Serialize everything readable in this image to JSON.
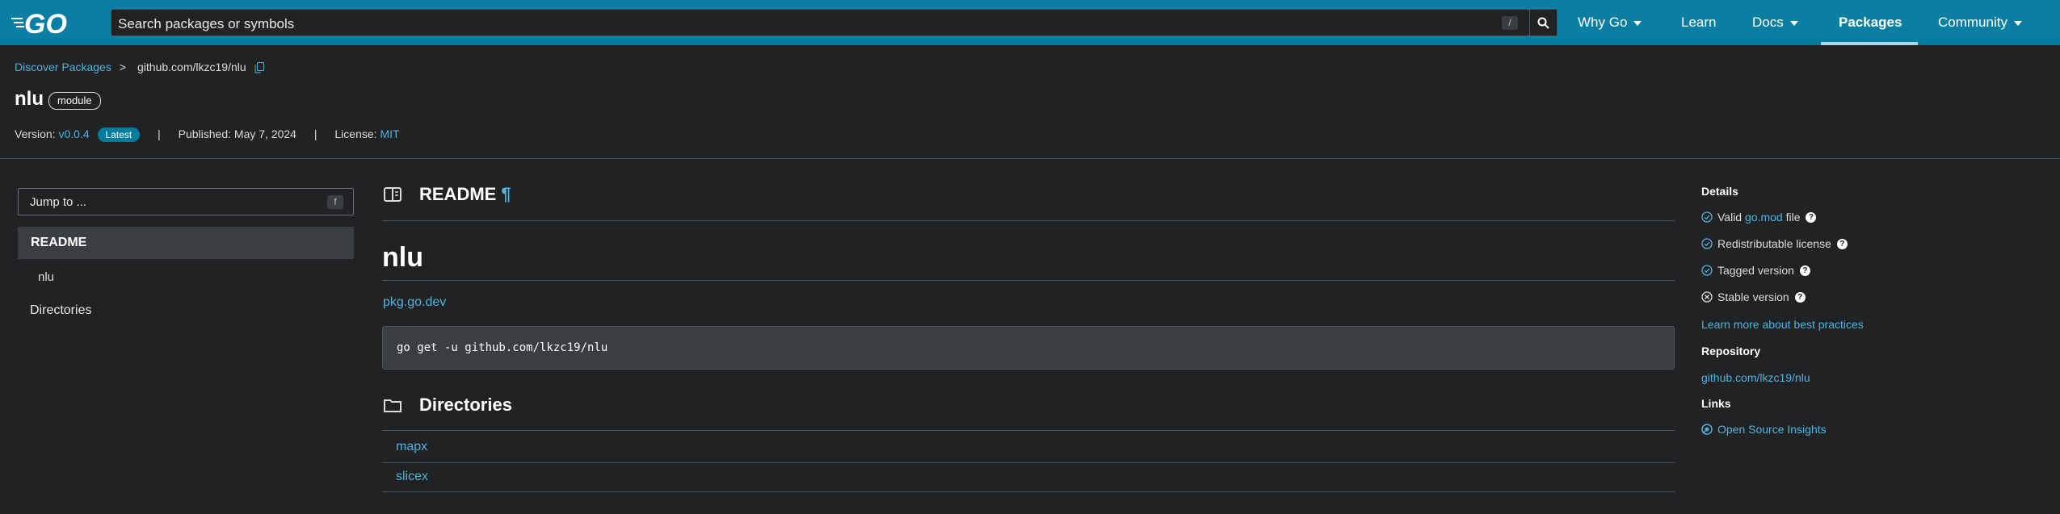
{
  "header": {
    "logo_text": "GO",
    "search_placeholder": "Search packages or symbols",
    "search_shortcut": "/",
    "nav": [
      {
        "label": "Why Go",
        "dropdown": true
      },
      {
        "label": "Learn",
        "dropdown": false
      },
      {
        "label": "Docs",
        "dropdown": true
      },
      {
        "label": "Packages",
        "dropdown": false,
        "active": true
      },
      {
        "label": "Community",
        "dropdown": true
      }
    ]
  },
  "breadcrumb": {
    "root": "Discover Packages",
    "separator": ">",
    "current": "github.com/lkzc19/nlu"
  },
  "package": {
    "name": "nlu",
    "kind_badge": "module",
    "version_label": "Version:",
    "version": "v0.0.4",
    "latest_badge": "Latest",
    "separator": "|",
    "published": "Published: May 7, 2024",
    "license_label": "License:",
    "license": "MIT"
  },
  "sidebar": {
    "jump_placeholder": "Jump to ...",
    "jump_shortcut": "f",
    "items": [
      {
        "label": "README",
        "active": true
      },
      {
        "label": "nlu",
        "sub": true
      },
      {
        "label": "Directories"
      }
    ]
  },
  "main": {
    "readme_heading": "README",
    "pilcrow": "¶",
    "readme_title": "nlu",
    "readme_link": "pkg.go.dev",
    "install_cmd": "go get -u github.com/lkzc19/nlu",
    "directories_heading": "Directories",
    "directories": [
      "mapx",
      "slicex"
    ]
  },
  "details": {
    "heading": "Details",
    "checks": [
      {
        "pre": "Valid ",
        "link": "go.mod",
        "post": " file",
        "ok": true
      },
      {
        "pre": "Redistributable license",
        "link": "",
        "post": "",
        "ok": true
      },
      {
        "pre": "Tagged version",
        "link": "",
        "post": "",
        "ok": true
      },
      {
        "pre": "Stable version",
        "link": "",
        "post": "",
        "ok": false
      }
    ],
    "best_practices": "Learn more about best practices",
    "repository_heading": "Repository",
    "repository": "github.com/lkzc19/nlu",
    "links_heading": "Links",
    "insights": "Open Source Insights"
  },
  "colors": {
    "header_bg": "#0a7fa3",
    "page_bg": "#202224",
    "link": "#4fb3e0",
    "badge": "#007d9c"
  }
}
